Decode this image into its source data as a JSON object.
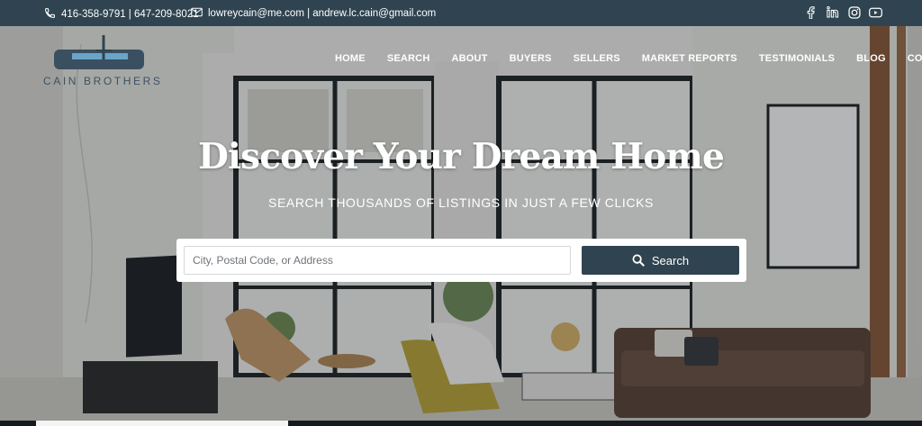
{
  "topbar": {
    "phones": "416-358-9791 | 647-209-8021",
    "emails": "lowreycain@me.com | andrew.lc.cain@gmail.com",
    "social": [
      "facebook-icon",
      "linkedin-icon",
      "instagram-icon",
      "youtube-icon"
    ]
  },
  "brand": {
    "name": "CAIN BROTHERS"
  },
  "nav": {
    "items": [
      "HOME",
      "SEARCH",
      "ABOUT",
      "BUYERS",
      "SELLERS",
      "MARKET REPORTS",
      "TESTIMONIALS",
      "BLOG",
      "CONTACT"
    ]
  },
  "hero": {
    "title": "Discover Your Dream Home",
    "subtitle": "SEARCH THOUSANDS OF LISTINGS IN JUST A FEW CLICKS"
  },
  "search": {
    "placeholder": "City, Postal Code, or Address",
    "value": "",
    "button_label": "Search"
  },
  "colors": {
    "primary": "#2f4450",
    "white": "#ffffff",
    "logo_blue": "#4a6070"
  }
}
